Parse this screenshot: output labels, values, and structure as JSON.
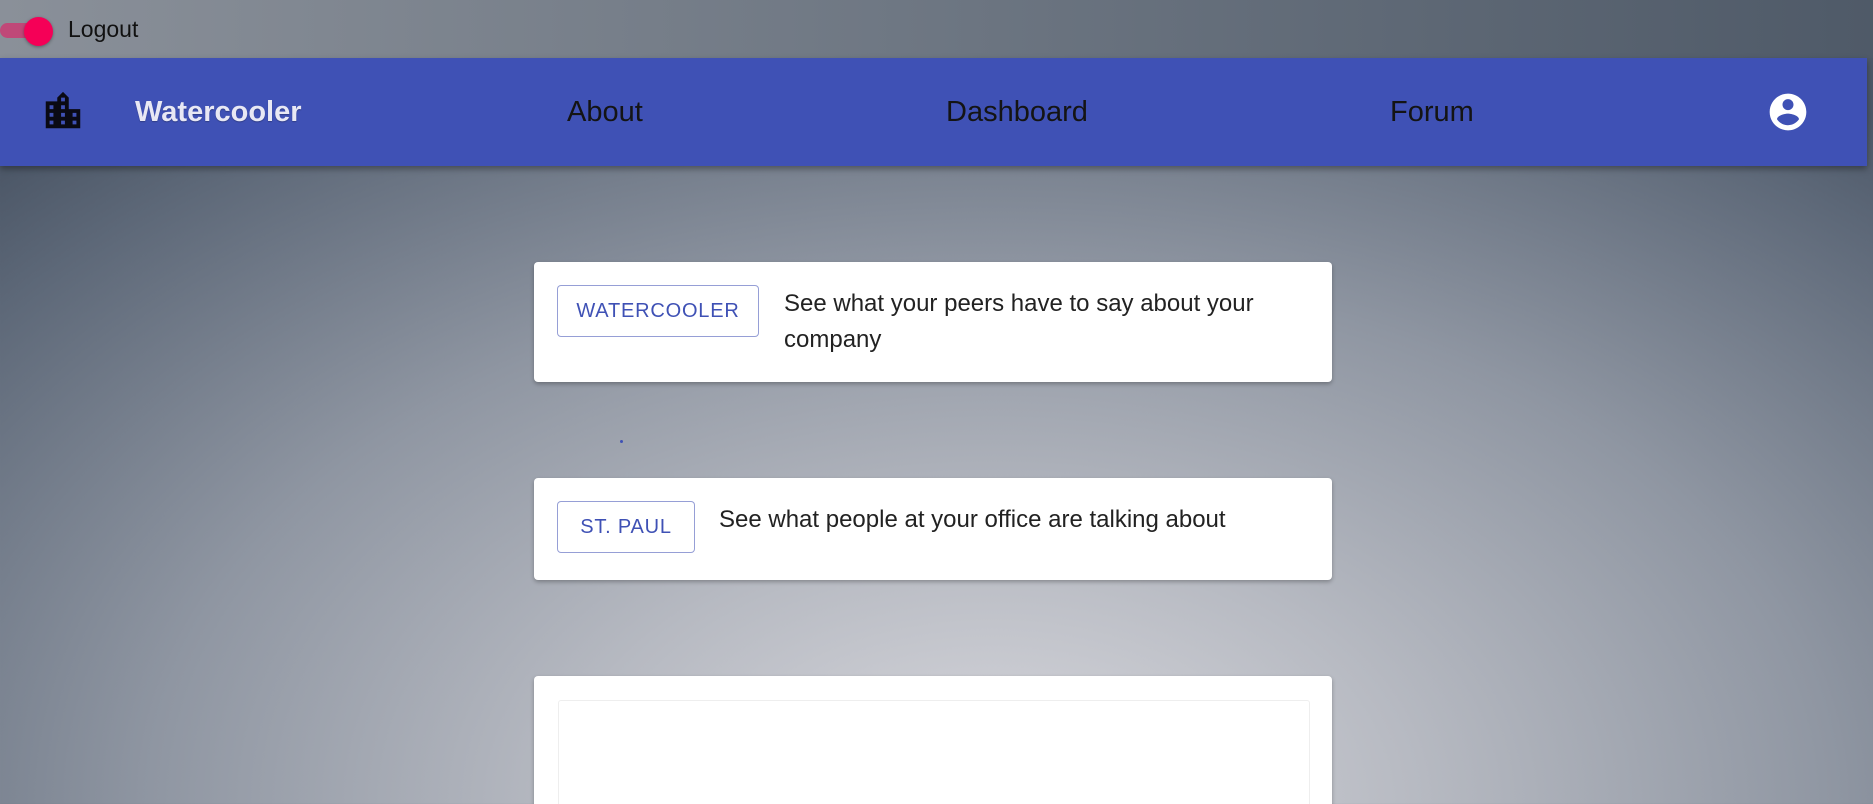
{
  "toggle": {
    "label": "Logout",
    "checked": true,
    "color": "#f50057"
  },
  "appbar": {
    "brand": "Watercooler",
    "logo_icon": "building-icon",
    "account_icon": "account-circle-icon",
    "color": "#3f51b5",
    "nav": [
      {
        "label": "About"
      },
      {
        "label": "Dashboard"
      },
      {
        "label": "Forum"
      }
    ]
  },
  "cards": [
    {
      "button_label": "WATERCOOLER",
      "description": "See what your peers have to say about your company"
    },
    {
      "button_label": "ST. PAUL",
      "description": "See what people at your office are talking about"
    }
  ]
}
